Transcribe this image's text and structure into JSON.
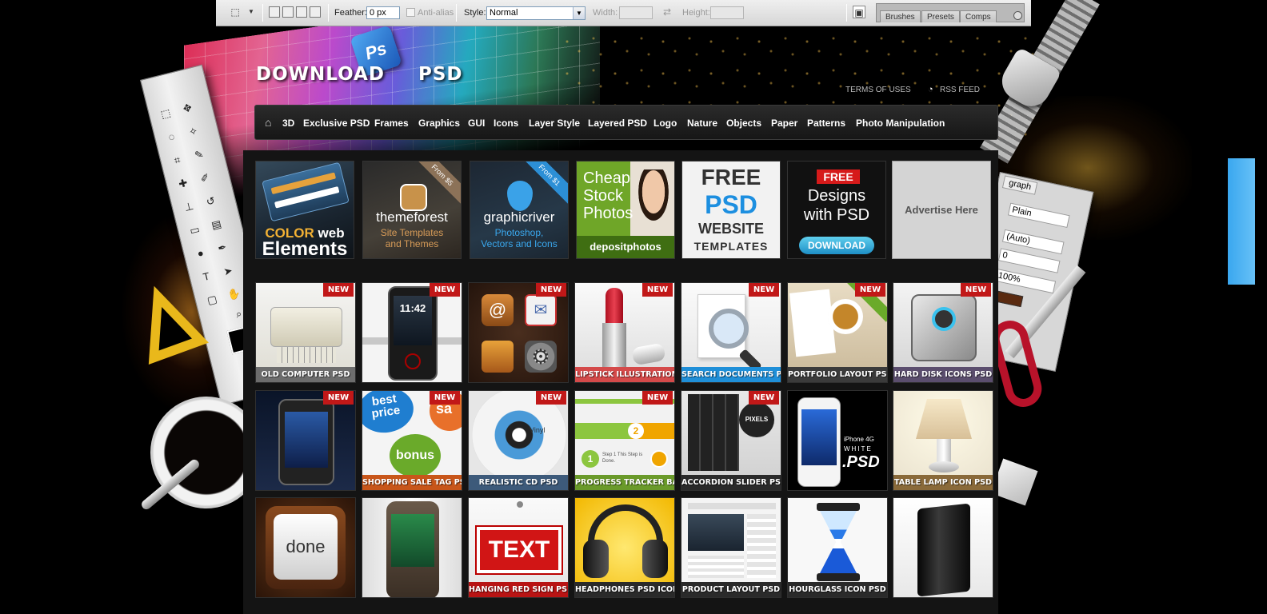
{
  "toolbar": {
    "feather_label": "Feather:",
    "feather_value": "0 px",
    "antialias_label": "Anti-alias",
    "style_label": "Style:",
    "style_value": "Normal",
    "width_label": "Width:",
    "height_label": "Height:",
    "panel_tabs": [
      "Brushes",
      "Presets",
      "Comps"
    ]
  },
  "header": {
    "logo_left": "DOWNLOAD",
    "logo_right": "PSD",
    "ps_badge": "Ps",
    "links": {
      "terms": "TERMS OF USES",
      "rss": "RSS FEED"
    }
  },
  "nav": {
    "items": [
      "3D",
      "Exclusive PSD",
      "Frames",
      "Graphics",
      "GUI",
      "Icons",
      "Layer Style",
      "Layered PSD",
      "Logo",
      "Nature",
      "Objects",
      "Paper",
      "Patterns",
      "Photo Manipulation"
    ]
  },
  "char_panel": {
    "tab": "graph",
    "font": "Plain",
    "leading": "(Auto)",
    "tracking": "0",
    "scale": "100%"
  },
  "ads": [
    {
      "l1": "COLOR",
      "l2": "web",
      "l3": "Elements"
    },
    {
      "badge": "From $5",
      "l1": "themeforest",
      "l2": "Site Templates",
      "l3": "and Themes"
    },
    {
      "badge": "From $1",
      "l1": "graphicriver",
      "l2": "Photoshop,",
      "l3": "Vectors and Icons"
    },
    {
      "l1": "Cheap",
      "l2": "Stock",
      "l3": "Photos",
      "l4": "depositphotos"
    },
    {
      "l1": "FREE",
      "l2": "PSD",
      "l3": "WEBSITE",
      "l4": "TEMPLATES"
    },
    {
      "l1": "FREE",
      "l2": "Designs",
      "l3": "with PSD",
      "l4": "DOWNLOAD"
    },
    {
      "l1": "Advertise Here"
    }
  ],
  "new_label": "NEW",
  "thumbs": [
    {
      "caption": "OLD COMPUTER PSD",
      "new": true,
      "bar": "#6d6d6d"
    },
    {
      "caption": "",
      "new": true,
      "bar": ""
    },
    {
      "caption": "",
      "new": true,
      "bar": ""
    },
    {
      "caption": "LIPSTICK ILLUSTRATION",
      "new": true,
      "bar": "#d44a4a"
    },
    {
      "caption": "SEARCH DOCUMENTS PSD",
      "new": true,
      "bar": "#1f8fd8"
    },
    {
      "caption": "PORTFOLIO LAYOUT PSD",
      "new": true,
      "bar": "#3b3b3b"
    },
    {
      "caption": "HARD DISK ICONS PSD",
      "new": true,
      "bar": "#5b4e6e"
    },
    {
      "caption": "",
      "new": true,
      "bar": ""
    },
    {
      "caption": "SHOPPING SALE TAG PSD",
      "new": true,
      "bar": "#c8561a"
    },
    {
      "caption": "REALISTIC CD PSD",
      "new": true,
      "bar": "#3d5a7a"
    },
    {
      "caption": "PROGRESS TRACKER BARS",
      "new": true,
      "bar": "#6a9a2a"
    },
    {
      "caption": "ACCORDION SLIDER PSD",
      "new": true,
      "bar": "#2a2a2a"
    },
    {
      "caption": "",
      "new": false,
      "bar": ""
    },
    {
      "caption": "TABLE LAMP ICON PSD",
      "new": false,
      "bar": "#8a6a3a"
    },
    {
      "caption": "",
      "new": false,
      "bar": ""
    },
    {
      "caption": "",
      "new": false,
      "bar": ""
    },
    {
      "caption": "HANGING RED SIGN PSD",
      "new": false,
      "bar": "#b81414"
    },
    {
      "caption": "HEADPHONES PSD ICON",
      "new": false,
      "bar": "#2a2a2a"
    },
    {
      "caption": "PRODUCT LAYOUT PSD",
      "new": false,
      "bar": "#2a2a2a"
    },
    {
      "caption": "HOURGLASS ICON PSD",
      "new": false,
      "bar": "#2a2a2a"
    },
    {
      "caption": "",
      "new": false,
      "bar": ""
    }
  ],
  "thumb_texts": {
    "phone_time": "11:42",
    "sale_best": "best",
    "sale_price": "price",
    "sale_bonus": "bonus",
    "sale_sa": "sa",
    "cd_label": "Vinyl",
    "prog_done": "1",
    "prog_step2": "2",
    "prog_text": "Step 1 This Step is Done.",
    "iphone_a": "iPhone 4G",
    "iphone_b": "WHITE",
    "iphone_c": ".PSD",
    "done_label": "done",
    "sign_text": "TEXT",
    "pixels": "PIXELS"
  }
}
